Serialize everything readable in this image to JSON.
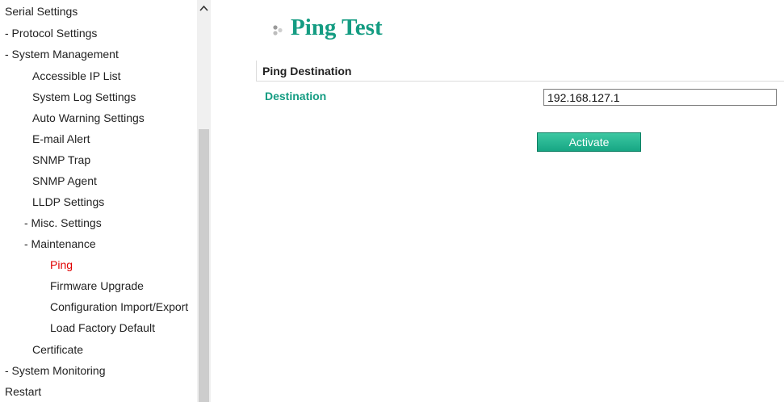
{
  "sidebar": {
    "items": [
      {
        "label": "Serial Settings"
      },
      {
        "label": "- Protocol Settings"
      },
      {
        "label": "- System Management"
      },
      {
        "label": "Accessible IP List"
      },
      {
        "label": "System Log Settings"
      },
      {
        "label": "Auto Warning Settings"
      },
      {
        "label": "E-mail Alert"
      },
      {
        "label": "SNMP Trap"
      },
      {
        "label": "SNMP Agent"
      },
      {
        "label": "LLDP Settings"
      },
      {
        "label": "- Misc. Settings"
      },
      {
        "label": "- Maintenance"
      },
      {
        "label": "Ping",
        "active": true
      },
      {
        "label": "Firmware Upgrade"
      },
      {
        "label": "Configuration Import/Export"
      },
      {
        "label": "Load Factory Default"
      },
      {
        "label": "Certificate"
      },
      {
        "label": "- System Monitoring"
      },
      {
        "label": "Restart"
      }
    ]
  },
  "main": {
    "title": "Ping Test",
    "section_header": "Ping Destination",
    "destination_label": "Destination",
    "destination_value": "192.168.127.1",
    "activate_label": "Activate"
  },
  "colors": {
    "accent": "#149c82",
    "active_nav": "#e00000",
    "button": "#17a684"
  }
}
